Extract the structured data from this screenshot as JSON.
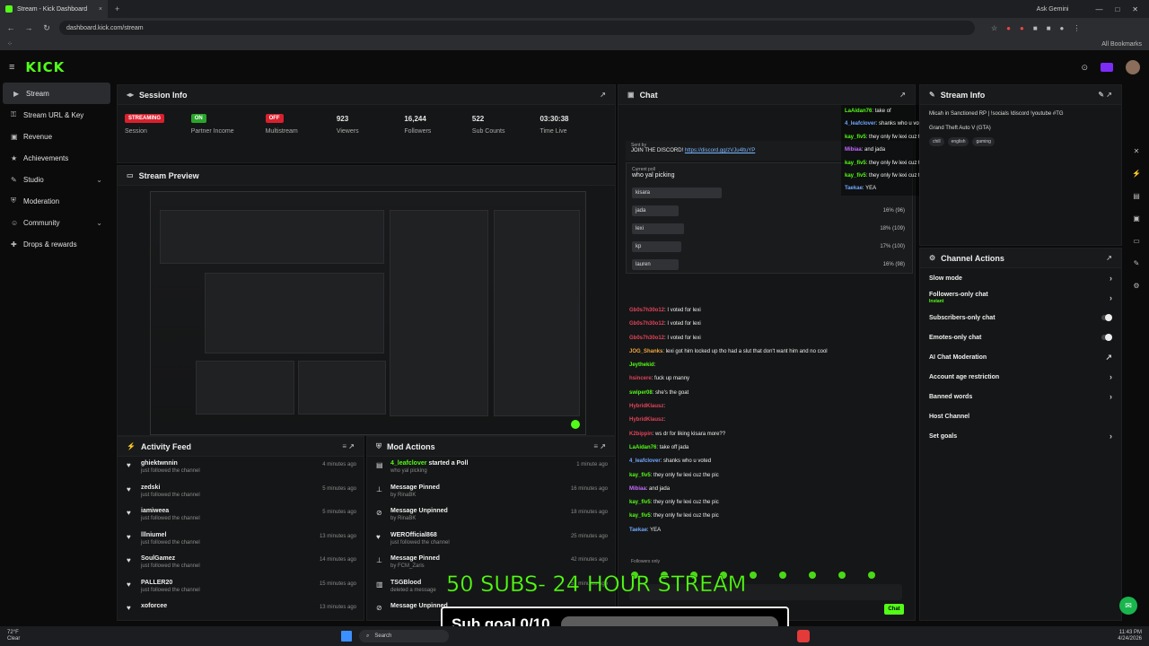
{
  "browser": {
    "tab_title": "Stream - Kick Dashboard",
    "new_tab": "+",
    "ask_gemini": "Ask Gemini",
    "url": "dashboard.kick.com/stream",
    "all_bookmarks": "All Bookmarks"
  },
  "app": {
    "logo": "KICK"
  },
  "sidebar": {
    "items": [
      {
        "label": "Stream",
        "icon": "video-icon",
        "active": true
      },
      {
        "label": "Stream URL & Key",
        "icon": "key-icon"
      },
      {
        "label": "Revenue",
        "icon": "wallet-icon"
      },
      {
        "label": "Achievements",
        "icon": "trophy-icon"
      },
      {
        "label": "Studio",
        "icon": "tools-icon",
        "chevron": true
      },
      {
        "label": "Moderation",
        "icon": "shield-icon"
      },
      {
        "label": "Community",
        "icon": "users-icon",
        "chevron": true
      },
      {
        "label": "Drops & rewards",
        "icon": "gift-icon"
      }
    ]
  },
  "session": {
    "title": "Session Info",
    "stats": [
      {
        "value": "STREAMING",
        "label": "Session",
        "pill": "red"
      },
      {
        "value": "ON",
        "label": "Partner Income",
        "pill": "green"
      },
      {
        "value": "OFF",
        "label": "Multistream",
        "pill": "red"
      },
      {
        "value": "923",
        "label": "Viewers"
      },
      {
        "value": "16,244",
        "label": "Followers"
      },
      {
        "value": "522",
        "label": "Sub Counts"
      },
      {
        "value": "03:30:38",
        "label": "Time Live"
      }
    ]
  },
  "preview": {
    "title": "Stream Preview"
  },
  "activity": {
    "title": "Activity Feed",
    "rows": [
      {
        "name": "ghiektwnnin",
        "sub": "just followed the channel",
        "time": "4 minutes ago"
      },
      {
        "name": "zedski",
        "sub": "just followed the channel",
        "time": "5 minutes ago"
      },
      {
        "name": "iamiweea",
        "sub": "just followed the channel",
        "time": "5 minutes ago"
      },
      {
        "name": "lllniumel",
        "sub": "just followed the channel",
        "time": "13 minutes ago"
      },
      {
        "name": "SoulGamez",
        "sub": "just followed the channel",
        "time": "14 minutes ago"
      },
      {
        "name": "PALLER20",
        "sub": "just followed the channel",
        "time": "15 minutes ago"
      },
      {
        "name": "xoforcee",
        "sub": "",
        "time": "13 minutes ago"
      }
    ]
  },
  "mod": {
    "title": "Mod Actions",
    "rows": [
      {
        "name": "4_leafclover",
        "action": "started a Poll",
        "sub": "who yal picking",
        "time": "1 minute ago"
      },
      {
        "name": "Message Pinned",
        "action": "",
        "sub": "by RinaBK",
        "time": "16 minutes ago"
      },
      {
        "name": "Message Unpinned",
        "action": "",
        "sub": "by RinaBK",
        "time": "18 minutes ago"
      },
      {
        "name": "WEROfficial868",
        "action": "",
        "sub": "just followed the channel",
        "time": "25 minutes ago"
      },
      {
        "name": "Message Pinned",
        "action": "",
        "sub": "by FCM_Zaris",
        "time": "42 minutes ago"
      },
      {
        "name": "TSGBlood",
        "action": "",
        "sub": "deleted a message",
        "time": "52 minutes ago"
      },
      {
        "name": "Message Unpinned",
        "action": "",
        "sub": "",
        "time": ""
      }
    ]
  },
  "chat": {
    "title": "Chat",
    "pinned_by": "Sent by",
    "pinned_text": "JOIN THE DISCORD!",
    "pinned_link": "https://discord.gg/zVJu4ltuYP",
    "poll_label": "Current poll",
    "poll_question": "who yal picking",
    "poll_options": [
      {
        "label": "kisara",
        "pct": "",
        "fill": 0.2
      },
      {
        "label": "jada",
        "pct": "16% (96)",
        "fill": 0.16
      },
      {
        "label": "lexi",
        "pct": "18% (109)",
        "fill": 0.18
      },
      {
        "label": "kp",
        "pct": "17% (100)",
        "fill": 0.17
      },
      {
        "label": "lauren",
        "pct": "16% (98)",
        "fill": 0.16
      }
    ],
    "messages": [
      {
        "user": "Gb0s7h30o12",
        "text": "I voted for lexi",
        "color": "r"
      },
      {
        "user": "Gb0s7h30o12",
        "text": "I voted for lexi",
        "color": "r"
      },
      {
        "user": "Gb0s7h30o12",
        "text": "I voted for lexi",
        "color": "r"
      },
      {
        "user": "JOG_Shanks",
        "text": "lexi got him locked up tho had a slut that don't want him and no cool",
        "color": "o"
      },
      {
        "user": "Jeythekid",
        "text": "",
        "color": "g"
      },
      {
        "user": "hsincere",
        "text": "fuck up manny",
        "color": "r"
      },
      {
        "user": "swiper08",
        "text": "she's the goat",
        "color": "g"
      },
      {
        "user": "HybridKlausz",
        "text": "",
        "color": "r"
      },
      {
        "user": "HybridKlausz",
        "text": "",
        "color": "r"
      },
      {
        "user": "K2bippin",
        "text": "ws dr for liking kisara more??",
        "color": "r"
      },
      {
        "user": "LaAidan76",
        "text": "take off jada",
        "color": "g"
      },
      {
        "user": "4_leafclover",
        "text": "shanks who u voted",
        "color": "b"
      },
      {
        "user": "kay_fiv5",
        "text": "they only fw lexi cuz the pic",
        "color": "g"
      },
      {
        "user": "Mibiaa",
        "text": "and jada",
        "color": "p"
      },
      {
        "user": "kay_fiv5",
        "text": "they only fw lexi cuz the pic",
        "color": "g"
      },
      {
        "user": "kay_fiv5",
        "text": "they only fw lexi cuz the pic",
        "color": "g"
      },
      {
        "user": "Taekae",
        "text": "YEA",
        "color": "b"
      }
    ],
    "overlay_messages": [
      {
        "user": "LaAidan76",
        "text": "take of",
        "color": "g"
      },
      {
        "user": "4_leafclover",
        "text": "shanks who u voted",
        "color": "b"
      },
      {
        "user": "kay_fiv5",
        "text": "they only fw lexi cuz the pic",
        "color": "g"
      },
      {
        "user": "Mibiaa",
        "text": "and jada",
        "color": "p"
      },
      {
        "user": "kay_fiv5",
        "text": "they only fw lexi cuz the pic",
        "color": "g"
      },
      {
        "user": "kay_fiv5",
        "text": "they only fw lexi cuz the pic",
        "color": "g"
      },
      {
        "user": "Taekae",
        "text": "YEA",
        "color": "b"
      }
    ],
    "followers_only": "Followers only",
    "send_label": "Chat"
  },
  "stream_info": {
    "title": "Stream Info",
    "stream_title": "Micah in Sanctioned RP | !socials !discord !youtube #TG",
    "category": "Grand Theft Auto V (GTA)",
    "tags": [
      "chill",
      "english",
      "gaming"
    ]
  },
  "channel_actions": {
    "title": "Channel Actions",
    "rows": [
      {
        "label": "Slow mode",
        "kind": "arrow"
      },
      {
        "label": "Followers-only chat",
        "kind": "arrow",
        "sub": "Instant"
      },
      {
        "label": "Subscribers-only chat",
        "kind": "toggle"
      },
      {
        "label": "Emotes-only chat",
        "kind": "toggle"
      },
      {
        "label": "AI Chat Moderation",
        "kind": "link"
      },
      {
        "label": "Account age restriction",
        "kind": "arrow"
      },
      {
        "label": "Banned words",
        "kind": "arrow"
      },
      {
        "label": "Host Channel",
        "kind": "none"
      },
      {
        "label": "Set goals",
        "kind": "arrow"
      }
    ]
  },
  "overlay": {
    "headline": "50 SUBS- 24 HOUR STREAM",
    "sub_goal": "Sub goal 0/10",
    "sub_goal_progress": 0
  },
  "taskbar": {
    "temp": "72°F",
    "weather": "Clear",
    "search": "Search",
    "time": "11:43 PM",
    "date": "4/24/2026"
  }
}
